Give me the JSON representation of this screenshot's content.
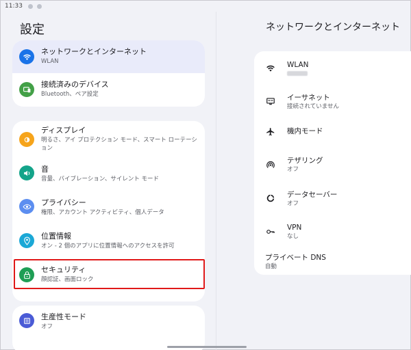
{
  "status_bar": {
    "time": "11:33"
  },
  "page_title": "設定",
  "colors": {
    "accent": "#e9ebfa",
    "highlight": "#e01818",
    "network_icon": "#1a73e8",
    "devices_icon": "#43a047",
    "display_icon": "#f6a41b",
    "sound_icon": "#14a48a",
    "privacy_icon": "#5c8ef0",
    "location_icon": "#1ba8d6",
    "security_icon": "#1e9e55",
    "productivity_icon": "#4a5bd6"
  },
  "settings": {
    "network": {
      "title": "ネットワークとインターネット",
      "subtitle": "WLAN",
      "icon": "wifi-icon"
    },
    "devices": {
      "title": "接続済みのデバイス",
      "subtitle": "Bluetooth、ペア設定",
      "icon": "devices-icon"
    },
    "display": {
      "title": "ディスプレイ",
      "subtitle": "明るさ、アイ プロテクション モード、スマート ローテーション",
      "icon": "brightness-icon"
    },
    "sound": {
      "title": "音",
      "subtitle": "音量、バイブレーション、サイレント モード",
      "icon": "volume-icon"
    },
    "privacy": {
      "title": "プライバシー",
      "subtitle": "権限、アカウント アクティビティ、個人データ",
      "icon": "eye-icon"
    },
    "location": {
      "title": "位置情報",
      "subtitle": "オン - 2 個のアプリに位置情報へのアクセスを許可",
      "icon": "location-pin-icon"
    },
    "security": {
      "title": "セキュリティ",
      "subtitle": "顔認証、画面ロック",
      "icon": "lock-icon"
    },
    "productivity": {
      "title": "生産性モード",
      "subtitle": "オフ",
      "icon": "productivity-icon"
    }
  },
  "detail": {
    "title": "ネットワークとインターネット",
    "items": {
      "wlan": {
        "title": "WLAN",
        "icon": "wifi-icon"
      },
      "ethernet": {
        "title": "イーサネット",
        "subtitle": "接続されていません",
        "icon": "ethernet-icon"
      },
      "airplane": {
        "title": "機内モード",
        "icon": "airplane-icon"
      },
      "tethering": {
        "title": "テザリング",
        "subtitle": "オフ",
        "icon": "hotspot-icon"
      },
      "data_saver": {
        "title": "データセーバー",
        "subtitle": "オフ",
        "icon": "data-saver-icon"
      },
      "vpn": {
        "title": "VPN",
        "subtitle": "なし",
        "icon": "vpn-key-icon"
      },
      "private_dns": {
        "title": "プライベート DNS",
        "subtitle": "自動"
      }
    }
  }
}
